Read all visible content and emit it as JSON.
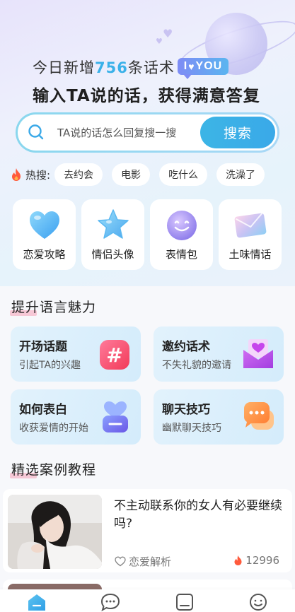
{
  "hero": {
    "headline_prefix": "今日新增",
    "headline_count": "756",
    "headline_suffix": "条话术",
    "badge_i": "I",
    "badge_you": "YOU",
    "subheadline": "输入TA说的话，获得满意答复"
  },
  "search": {
    "placeholder": "TA说的话怎么回复搜一搜",
    "button_label": "搜索"
  },
  "hot_search": {
    "label": "热搜:",
    "tags": [
      "去约会",
      "电影",
      "吃什么",
      "洗澡了"
    ]
  },
  "categories": [
    {
      "label": "恋爱攻略",
      "icon": "heart-icon"
    },
    {
      "label": "情侣头像",
      "icon": "star-icon"
    },
    {
      "label": "表情包",
      "icon": "smiley-icon"
    },
    {
      "label": "土味情话",
      "icon": "envelope-icon"
    }
  ],
  "section_charm": {
    "title": "提升语言魅力",
    "items": [
      {
        "title": "开场话题",
        "subtitle": "引起TA的兴趣",
        "icon": "hashtag-icon"
      },
      {
        "title": "邀约话术",
        "subtitle": "不失礼貌的邀请",
        "icon": "love-letter-icon"
      },
      {
        "title": "如何表白",
        "subtitle": "收获爱情的开始",
        "icon": "heart-chat-icon"
      },
      {
        "title": "聊天技巧",
        "subtitle": "幽默聊天技巧",
        "icon": "chat-bubbles-icon"
      }
    ]
  },
  "section_cases": {
    "title": "精选案例教程",
    "cards": [
      {
        "title": "不主动联系你的女人有必要继续吗?",
        "tag": "恋爱解析",
        "count": "12996"
      }
    ]
  },
  "tabbar": {
    "tabs": [
      "home-icon",
      "chat-icon",
      "square-icon",
      "smile-icon"
    ]
  },
  "colors": {
    "accent": "#3ab1e9",
    "highlight": "#f6c8d6",
    "hot": "#ff5a3c"
  }
}
